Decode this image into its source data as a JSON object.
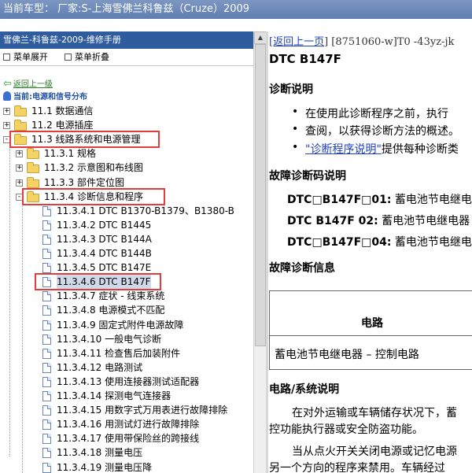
{
  "titlebar": {
    "text": "当前车型： 厂家:S-上海雪佛兰科鲁兹（Cruze）2009"
  },
  "left_panel": {
    "header": "雪佛兰-科鲁兹-2009-维修手册",
    "expand_all": "菜单展开",
    "collapse_all": "菜单折叠",
    "back_link": "返回上一级",
    "current": "当前:电源和信号分布"
  },
  "tree": [
    {
      "label": "11.1 数据通信",
      "type": "folder",
      "level": 0,
      "expander": "+"
    },
    {
      "label": "11.2 电源插座",
      "type": "folder",
      "level": 0,
      "expander": "+"
    },
    {
      "label": "11.3 线路系统和电源管理",
      "type": "folder",
      "level": 0,
      "expander": "−",
      "highlight": true
    },
    {
      "label": "11.3.1 规格",
      "type": "folder",
      "level": 1,
      "expander": "+"
    },
    {
      "label": "11.3.2 示意图和布线图",
      "type": "folder",
      "level": 1,
      "expander": "+"
    },
    {
      "label": "11.3.3 部件定位图",
      "type": "folder",
      "level": 1,
      "expander": "+"
    },
    {
      "label": "11.3.4 诊断信息和程序",
      "type": "folder",
      "level": 1,
      "expander": "−",
      "highlight": true
    },
    {
      "label": "11.3.4.1 DTC B1370-B1379、B1380-B",
      "type": "doc",
      "level": 2
    },
    {
      "label": "11.3.4.2 DTC B1445",
      "type": "doc",
      "level": 2
    },
    {
      "label": "11.3.4.3 DTC B144A",
      "type": "doc",
      "level": 2
    },
    {
      "label": "11.3.4.4 DTC B144B",
      "type": "doc",
      "level": 2
    },
    {
      "label": "11.3.4.5 DTC B147E",
      "type": "doc",
      "level": 2
    },
    {
      "label": "11.3.4.6 DTC B147F",
      "type": "doc",
      "level": 2,
      "highlight": true,
      "selected": true
    },
    {
      "label": "11.3.4.7 症状 - 线束系统",
      "type": "doc",
      "level": 2
    },
    {
      "label": "11.3.4.8 电源模式不匹配",
      "type": "doc",
      "level": 2
    },
    {
      "label": "11.3.4.9 固定式附件电源故障",
      "type": "doc",
      "level": 2
    },
    {
      "label": "11.3.4.10 一般电气诊断",
      "type": "doc",
      "level": 2
    },
    {
      "label": "11.3.4.11 检查售后加装附件",
      "type": "doc",
      "level": 2
    },
    {
      "label": "11.3.4.12 电路测试",
      "type": "doc",
      "level": 2
    },
    {
      "label": "11.3.4.13 使用连接器测试适配器",
      "type": "doc",
      "level": 2
    },
    {
      "label": "11.3.4.14 探测电气连接器",
      "type": "doc",
      "level": 2
    },
    {
      "label": "11.3.4.15 用数字式万用表进行故障排除",
      "type": "doc",
      "level": 2
    },
    {
      "label": "11.3.4.16 用测试灯进行故障排除",
      "type": "doc",
      "level": 2
    },
    {
      "label": "11.3.4.17 使用带保险丝的跨接线",
      "type": "doc",
      "level": 2
    },
    {
      "label": "11.3.4.18 测量电压",
      "type": "doc",
      "level": 2
    },
    {
      "label": "11.3.4.19 测量电压降",
      "type": "doc",
      "level": 2
    }
  ],
  "content": {
    "back_link": "[返回上一页",
    "doc_code": "] [8751060-w]T0 -43yz-jk",
    "title": "DTC B147F",
    "section1": "诊断说明",
    "bullets": [
      {
        "text": "在使用此诊断程序之前，执行"
      },
      {
        "text": "查阅，以获得诊断方法的概述。"
      },
      {
        "link": "\"诊断程序说明\"",
        "text": "提供每种诊断类"
      }
    ],
    "section2": "故障诊断码说明",
    "dtcs": [
      {
        "code": "DTC□B147F□01:",
        "desc": " 蓄电池节电继电"
      },
      {
        "code": "DTC B147F 02:",
        "desc": " 蓄电池节电继电器"
      },
      {
        "code": "DTC□B147F□04:",
        "desc": " 蓄电池节电继电"
      }
    ],
    "section3": "故障诊断信息",
    "table_header": "电路",
    "table_cell": "蓄电池节电继电器 – 控制电路",
    "section4": "电路/系统说明",
    "para1_line1": "在对外运输或车辆储存状况下，蓄",
    "para1_line2": "控功能执行器或安全防盗功能。",
    "para2_line1": "当从点火开关关闭电源或记忆电源",
    "para2_line2": "另一个方向的程序来禁用。车辆经过"
  }
}
